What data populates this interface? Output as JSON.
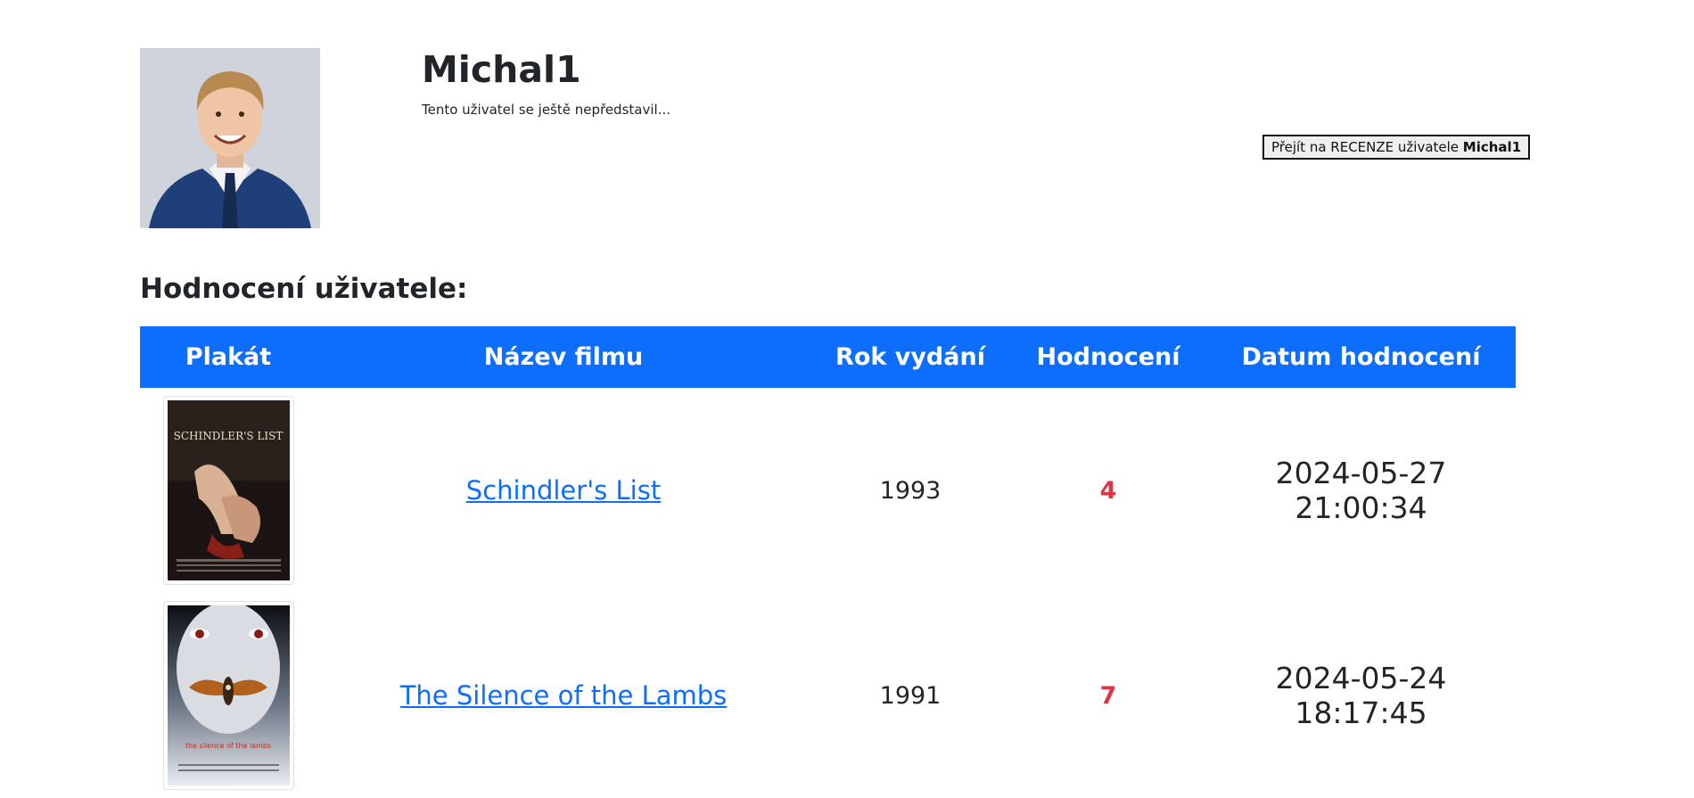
{
  "profile": {
    "username": "Michal1",
    "bio": "Tento uživatel se ještě nepředstavil...",
    "reviews_button": {
      "prefix": "Přejít na RECENZE uživatele ",
      "username": "Michal1"
    }
  },
  "ratings": {
    "title": "Hodnocení uživatele:",
    "columns": [
      "Plakát",
      "Název filmu",
      "Rok vydání",
      "Hodnocení",
      "Datum hodnocení"
    ],
    "rows": [
      {
        "poster": "schindlers-list-poster",
        "poster_text": "SCHINDLER'S LIST",
        "title": "Schindler's List",
        "year": "1993",
        "rating": "4",
        "date": "2024-05-27 21:00:34"
      },
      {
        "poster": "silence-of-the-lambs-poster",
        "poster_text": "the silence of the lambs",
        "title": "The Silence of the Lambs",
        "year": "1991",
        "rating": "7",
        "date": "2024-05-24 18:17:45"
      }
    ]
  },
  "colors": {
    "header_bg": "#0d6efd",
    "link": "#0d6efd",
    "rating": "#dc3545",
    "text": "#212529"
  }
}
